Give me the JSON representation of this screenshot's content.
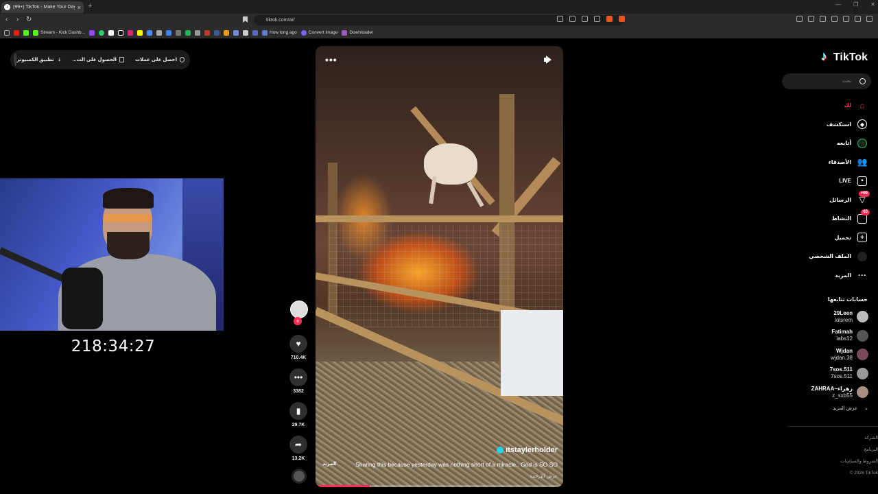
{
  "browser": {
    "tab_title": "(99+) TikTok - Make Your Day",
    "url": "tiktok.com/ar/",
    "bookmarks": [
      "Stream - Kick Dashb...",
      "How long ago",
      "Convert Image",
      "Downloader"
    ]
  },
  "overlay": {
    "get_coins": "احصل على عملات",
    "get_app": "الحصول على الت...",
    "desktop_app": "تطبيق الكمبيوتر",
    "timer": "218:34:27"
  },
  "video": {
    "author": "itstaylerholder",
    "caption": "Sharing this because yesterday was nothing short of a miracle.. God is SO SO",
    "more": "المزيد",
    "translate": "عرض الترجمة",
    "progress": 0.22
  },
  "actions": {
    "likes": "710.4K",
    "comments": "3382",
    "saves": "29.7K",
    "shares": "13.2K"
  },
  "sidebar": {
    "brand": "TikTok",
    "search_placeholder": "بحث",
    "nav": [
      {
        "label": "لك",
        "icon": "home-icon"
      },
      {
        "label": "استكشف",
        "icon": "compass-icon"
      },
      {
        "label": "أتابعه",
        "icon": "following-avatar-icon"
      },
      {
        "label": "الأصدقاء",
        "icon": "friends-icon"
      },
      {
        "label": "LIVE",
        "icon": "live-icon"
      },
      {
        "label": "الرسائل",
        "icon": "messages-icon",
        "badge": "+99"
      },
      {
        "label": "النشاط",
        "icon": "activity-icon",
        "badge": "63"
      },
      {
        "label": "تحميل",
        "icon": "upload-icon"
      },
      {
        "label": "الملف الشخصي",
        "icon": "profile-icon"
      },
      {
        "label": "المزيد",
        "icon": "more-icon"
      }
    ],
    "following_title": "حسابات تتابعها",
    "accounts": [
      {
        "name": "29Leen",
        "handle": "lolsrem"
      },
      {
        "name": "Fatimah",
        "handle": "iabs12"
      },
      {
        "name": "Wjdan",
        "handle": "wjdan.38"
      },
      {
        "name": "7sos.511",
        "handle": "7sos.511"
      },
      {
        "name": "ZAHRAA~زهراء",
        "handle": "z_sxb55"
      }
    ],
    "see_more": "عرض المزيد",
    "footer": [
      "الشركة",
      "البرنامج",
      "الشروط والسياسات",
      "© 2026 TikTok"
    ]
  },
  "colors": {
    "accent": "#fe2c55",
    "verified": "#20d5ec"
  }
}
